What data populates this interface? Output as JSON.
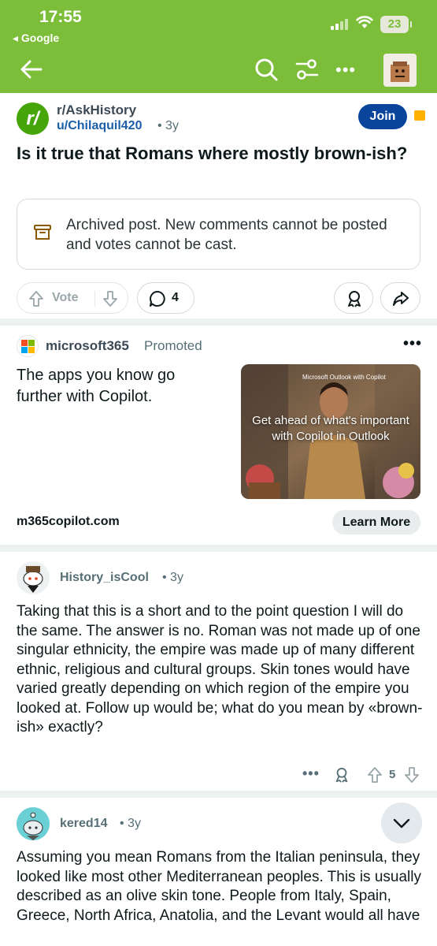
{
  "status_bar": {
    "time": "17:55",
    "back_app": "◂ Google",
    "battery": "23"
  },
  "subreddit": {
    "name": "r/AskHistory",
    "icon_letter": "r/"
  },
  "post": {
    "author": "u/Chilaquil420",
    "age": "• 3y",
    "join_label": "Join",
    "title": "Is it true that Romans where mostly brown-ish?",
    "archived_notice": "Archived post. New comments cannot be posted and votes cannot be cast.",
    "vote_label": "Vote",
    "comment_count": "4"
  },
  "ad": {
    "advertiser": "microsoft365",
    "promoted_label": "Promoted",
    "more": "•••",
    "headline": "The apps you know go further with Copilot.",
    "image_brand": "Microsoft Outlook with Copilot",
    "image_caption": "Get ahead of what's important with Copilot in Outlook",
    "url": "m365copilot.com",
    "cta": "Learn More"
  },
  "comments": [
    {
      "author": "History_isCool",
      "age": "• 3y",
      "body": "Taking that this is a short and to the point question I will do the same. The answer is no. Roman was not made up of one singular ethnicity, the empire was made up of many different ethnic, religious and cultural groups. Skin tones would have varied greatly depending on which region of the empire you looked at. Follow up would be; what do you mean by «brown-ish» exactly?",
      "score": "5",
      "more": "•••"
    },
    {
      "author": "kered14",
      "age": "• 3y",
      "body": "Assuming you mean Romans from the Italian peninsula, they looked like most other Mediterranean peoples. This is usually described as an olive skin tone. People from Italy, Spain, Greece, North Africa, Anatolia, and the Levant would all have"
    }
  ],
  "colors": {
    "header": "#7cbd3a",
    "join": "#0a449b",
    "subreddit_icon": "#46a508"
  }
}
